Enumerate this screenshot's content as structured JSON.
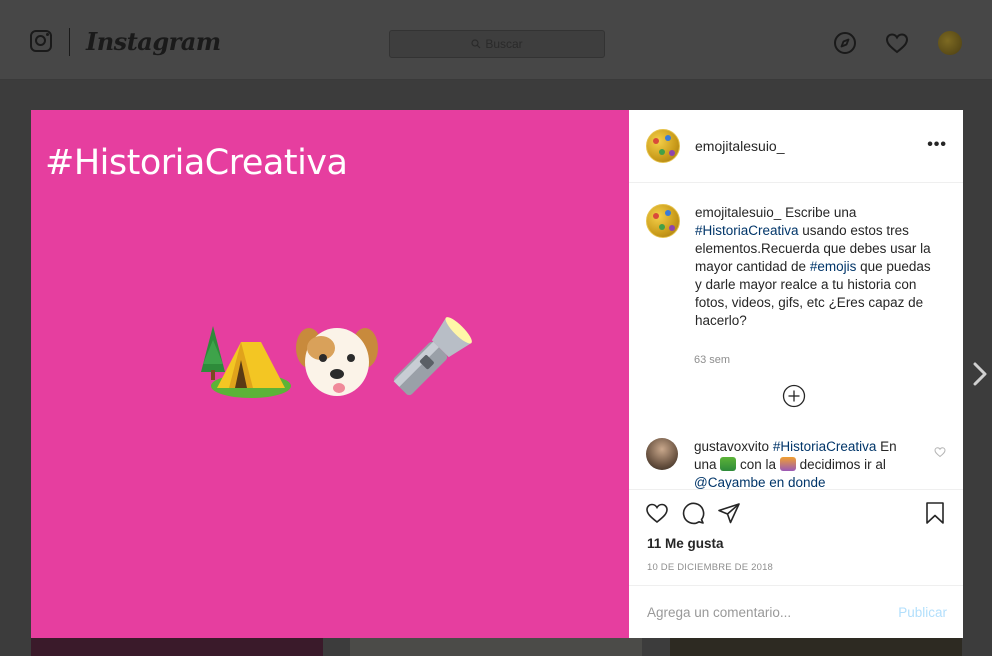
{
  "nav": {
    "logo": "Instagram",
    "search_placeholder": "Buscar",
    "icons": [
      "instagram-glyph-icon",
      "compass-icon",
      "heart-icon",
      "profile-avatar"
    ]
  },
  "post": {
    "media": {
      "title": "#HistoriaCreativa",
      "emojis": [
        "camping-tent-icon",
        "dog-face-icon",
        "flashlight-icon"
      ],
      "background": "#e63e9f"
    },
    "author": {
      "username": "emojitalesuio_",
      "more_label": "•••"
    },
    "caption": {
      "username": "emojitalesuio_",
      "text_1": " Escribe una ",
      "tag_1": "#HistoriaCreativa",
      "text_2": " usando estos tres elementos.Recuerda que debes usar la mayor cantidad de ",
      "tag_2": "#emojis",
      "text_3": " que puedas y darle mayor realce a tu historia con fotos, videos, gifs, etc ¿Eres capaz de hacerlo?",
      "time": "63 sem"
    },
    "comments": [
      {
        "username": "gustavoxvito",
        "tag": "#HistoriaCreativa",
        "text_1": " En una ",
        "text_2": " con la ",
        "text_3": " decidimos ir al ",
        "text_4": "@Cayambe en donde"
      }
    ],
    "likes": "11 Me gusta",
    "date": "10 DE DICIEMBRE DE 2018",
    "add_comment_placeholder": "Agrega un comentario...",
    "publish_label": "Publicar"
  },
  "colors": {
    "accent_link": "#003569",
    "publish_disabled": "#b2dffc",
    "media_bg": "#e63e9f"
  }
}
